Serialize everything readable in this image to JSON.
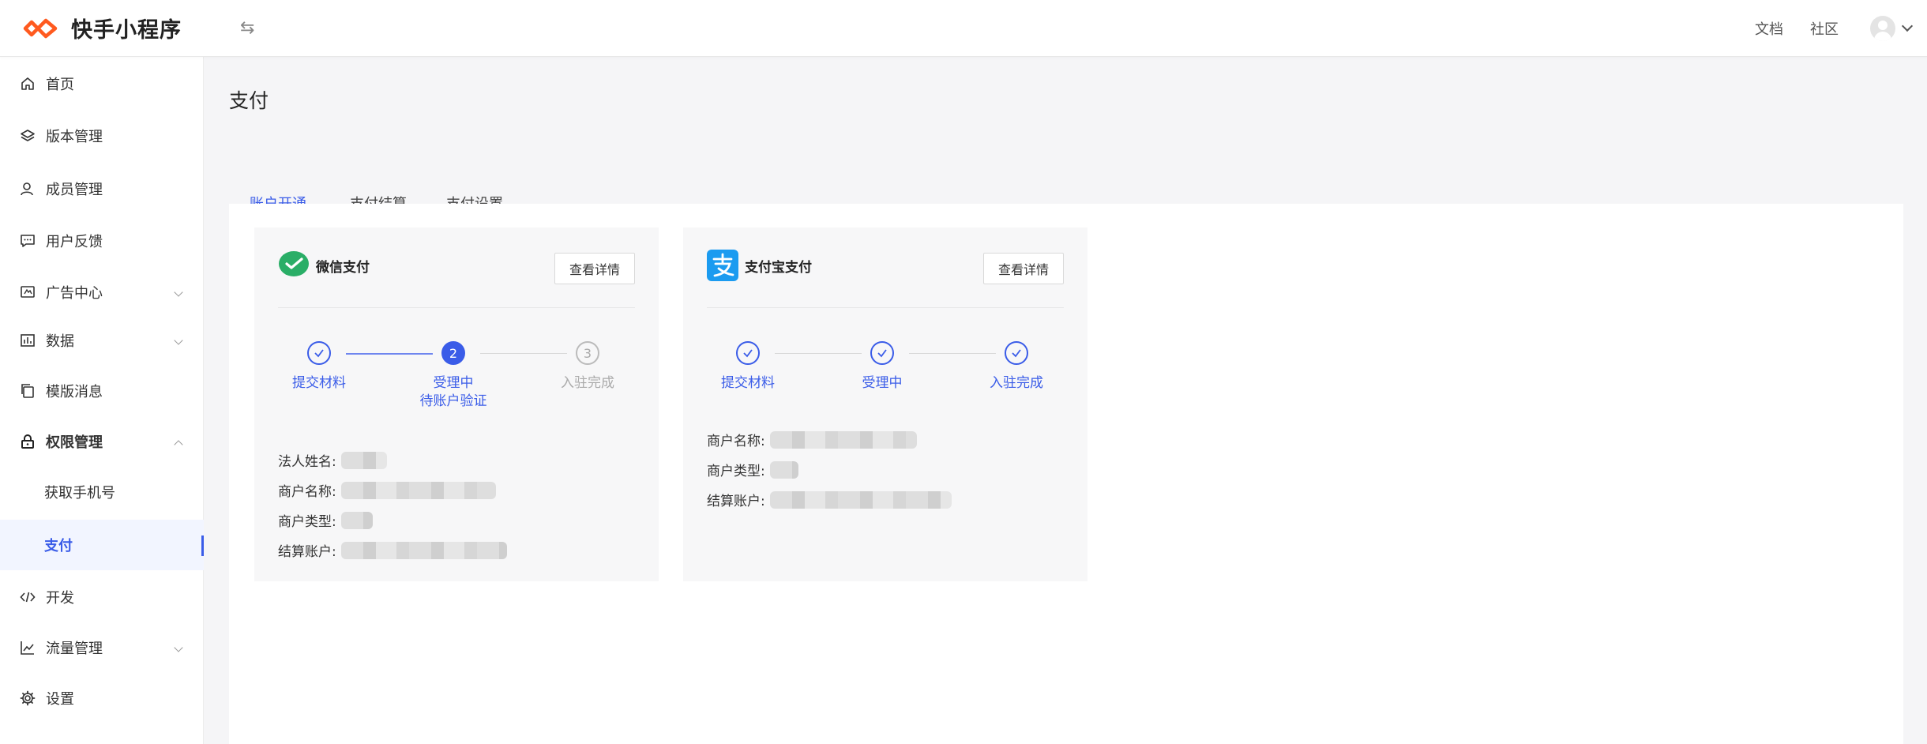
{
  "app": {
    "title": "快手小程序"
  },
  "header": {
    "links": [
      "文档",
      "社区"
    ]
  },
  "sidebar": {
    "items": [
      {
        "label": "首页"
      },
      {
        "label": "版本管理"
      },
      {
        "label": "成员管理"
      },
      {
        "label": "用户反馈"
      },
      {
        "label": "广告中心"
      },
      {
        "label": "数据"
      },
      {
        "label": "模版消息"
      },
      {
        "label": "权限管理"
      },
      {
        "label": "获取手机号"
      },
      {
        "label": "支付"
      },
      {
        "label": "开发"
      },
      {
        "label": "流量管理"
      },
      {
        "label": "设置"
      }
    ]
  },
  "page": {
    "title": "支付",
    "tabs": [
      "账户开通",
      "支付结算",
      "支付设置"
    ]
  },
  "cards": [
    {
      "name": "微信支付",
      "button": "查看详情",
      "steps": [
        "提交材料",
        "受理中",
        "入驻完成"
      ],
      "step2_sub": "待账户验证",
      "step3_num": "3",
      "step2_num": "2",
      "fields": [
        "法人姓名:",
        "商户名称:",
        "商户类型:",
        "结算账户:"
      ]
    },
    {
      "name": "支付宝支付",
      "button": "查看详情",
      "steps": [
        "提交材料",
        "受理中",
        "入驻完成"
      ],
      "fields": [
        "商户名称:",
        "商户类型:",
        "结算账户:"
      ]
    }
  ],
  "colors": {
    "accent": "#3a5ce8",
    "wechat": "#2aae67",
    "alipay": "#1b9bf0",
    "brand": "#ff5a1f"
  }
}
